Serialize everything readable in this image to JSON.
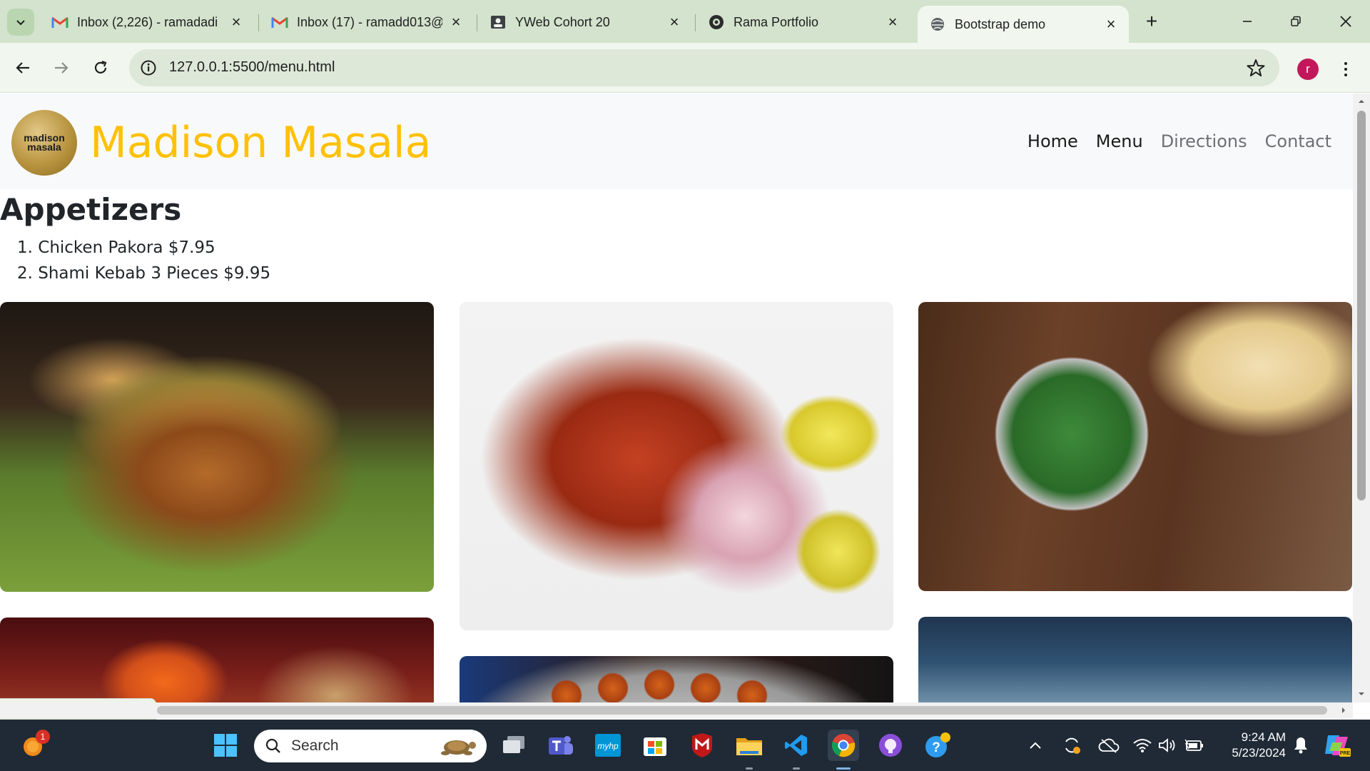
{
  "browser": {
    "tabs": [
      {
        "title": "Inbox (2,226) - ramadadi",
        "icon": "gmail-icon"
      },
      {
        "title": "Inbox (17) - ramadd013@",
        "icon": "gmail-icon"
      },
      {
        "title": "YWeb Cohort 20",
        "icon": "classroom-icon"
      },
      {
        "title": "Rama Portfolio",
        "icon": "github-cat-icon"
      },
      {
        "title": "Bootstrap demo",
        "icon": "globe-icon",
        "active": true
      }
    ],
    "url": "127.0.0.1:5500/menu.html",
    "profile_initial": "r",
    "status_url": "127.0.0.1:5500/menu.html"
  },
  "site": {
    "logo_line1": "madison",
    "logo_line2": "masala",
    "brand": "Madison Masala",
    "brand_color": "#ffc107",
    "nav": [
      "Home",
      "Menu",
      "Directions",
      "Contact"
    ],
    "section_title": "Appetizers",
    "items": [
      "1. Chicken Pakora $7.95",
      "2. Shami Kebab 3 Pieces $9.95"
    ],
    "photos": [
      "biryani",
      "tandoori-chicken",
      "palak-paneer",
      "butter-chicken",
      "gulab-jamun",
      "sky"
    ]
  },
  "taskbar": {
    "search_placeholder": "Search",
    "time": "9:24 AM",
    "date": "5/23/2024",
    "notification_count": "1",
    "apps": [
      "start",
      "task-view",
      "teams",
      "myhp",
      "store",
      "mcafee",
      "file-explorer",
      "vscode",
      "chrome",
      "github-desktop",
      "help"
    ]
  }
}
